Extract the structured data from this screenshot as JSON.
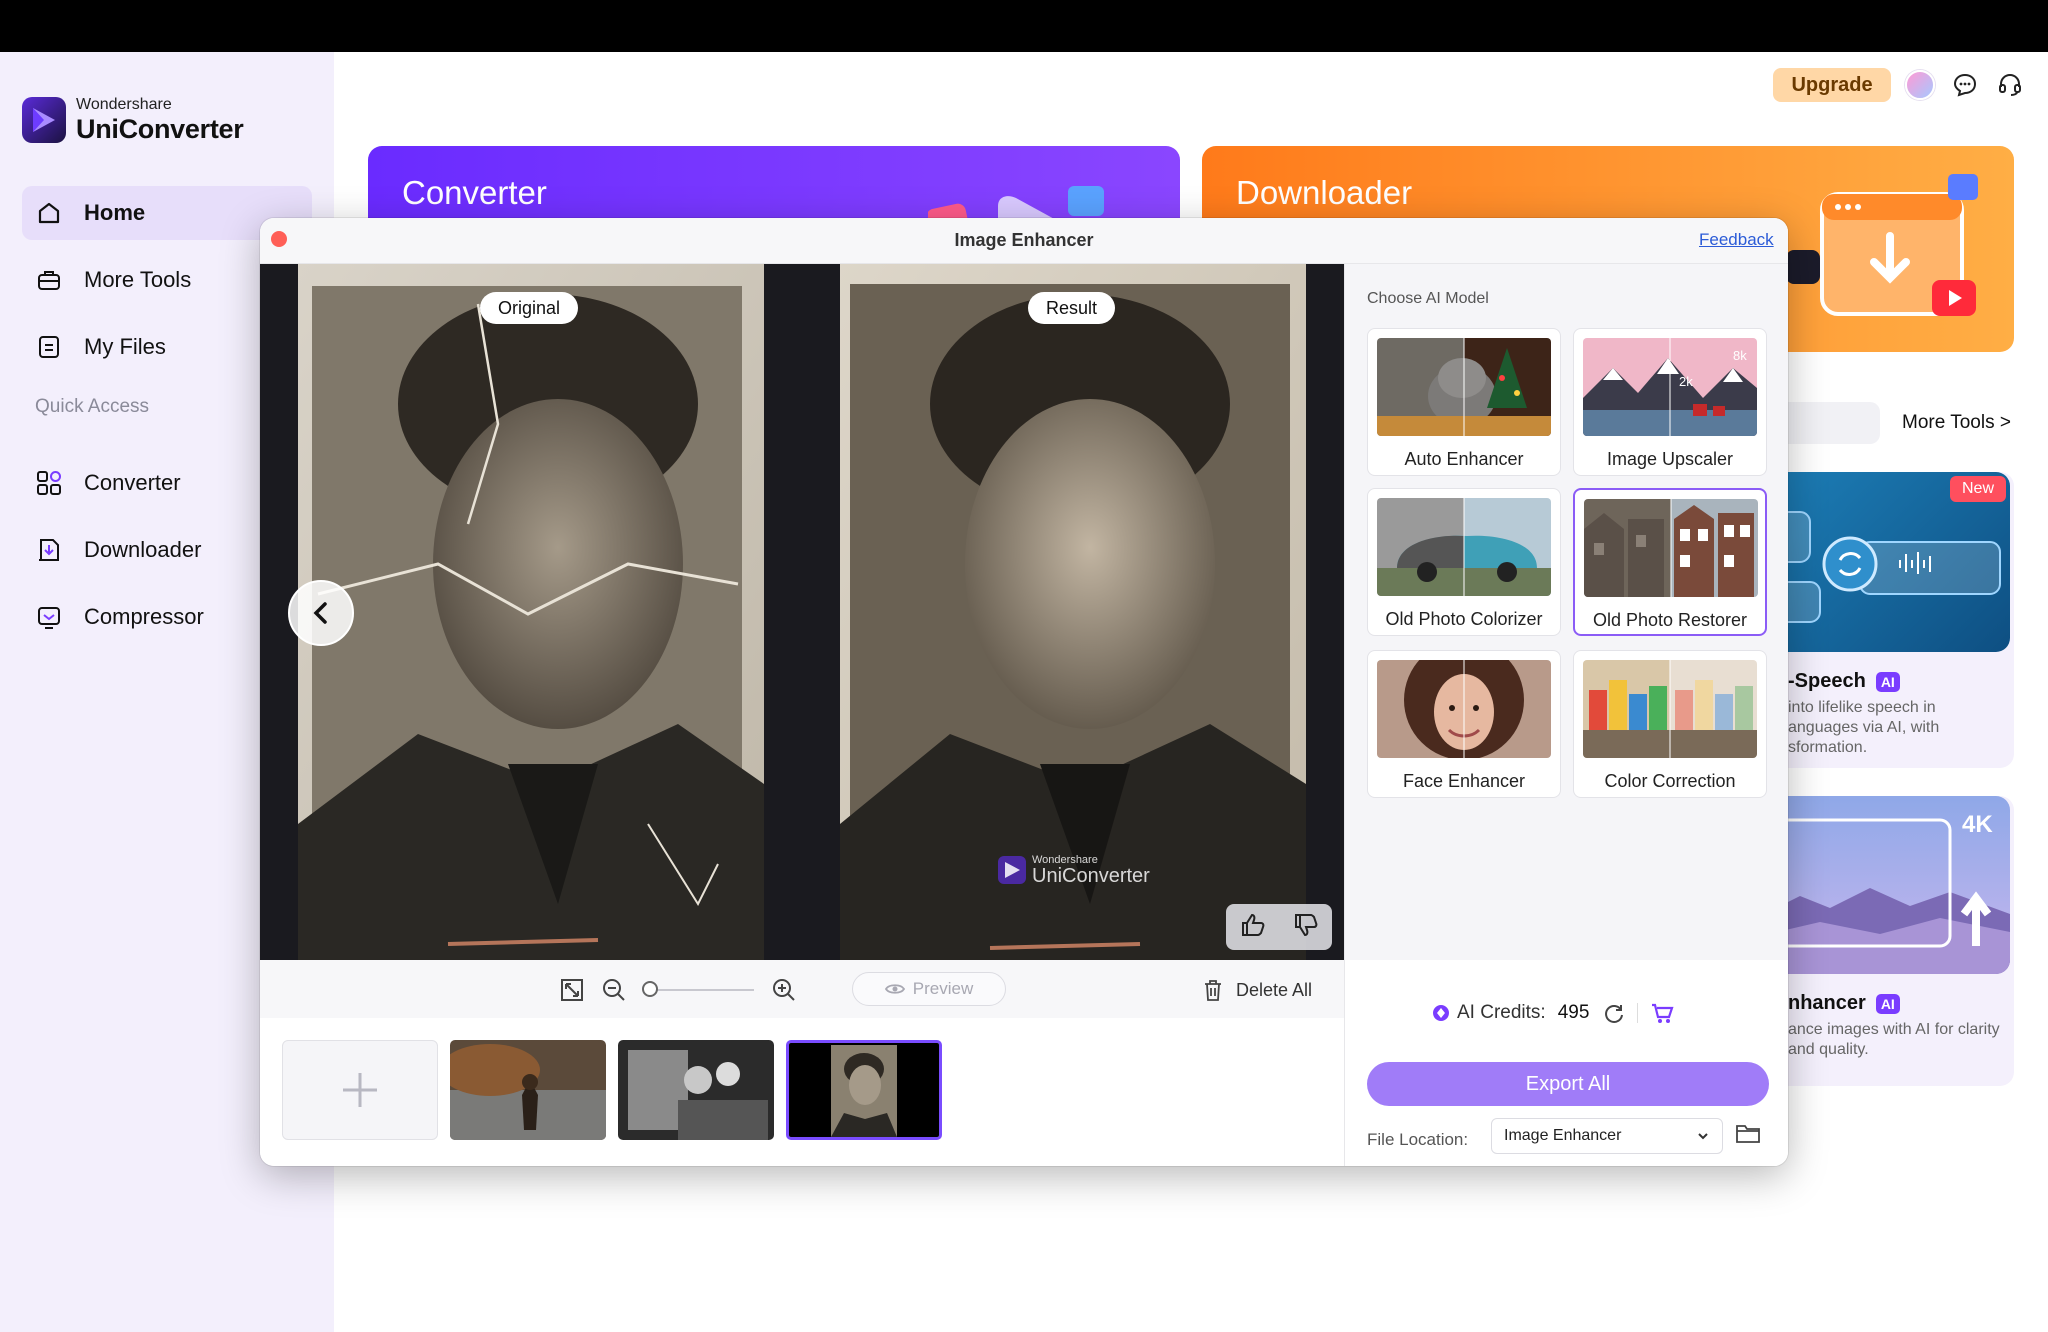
{
  "app": {
    "brand_small": "Wondershare",
    "brand_big": "UniConverter",
    "accent": "#7a3cff"
  },
  "sidebar": {
    "items": [
      {
        "label": "Home",
        "icon": "home-icon",
        "active": true
      },
      {
        "label": "More Tools",
        "icon": "toolbox-icon"
      },
      {
        "label": "My Files",
        "icon": "files-icon"
      }
    ],
    "quick_access_label": "Quick Access",
    "quick_items": [
      {
        "label": "Converter",
        "icon": "converter-icon"
      },
      {
        "label": "Downloader",
        "icon": "downloader-icon"
      },
      {
        "label": "Compressor",
        "icon": "compressor-icon"
      }
    ]
  },
  "header": {
    "upgrade_label": "Upgrade"
  },
  "cards": {
    "converter_title": "Converter",
    "downloader_title": "Downloader",
    "more_tools_link": "More Tools >",
    "new_badge": "New",
    "speech_title": "-Speech",
    "speech_desc": "into lifelike speech in anguages via AI, with sformation.",
    "enhancer_title": "nhancer",
    "enhancer_desc": "ance images with AI for clarity and quality.",
    "ai_badge": "AI",
    "fourk_label": "4K"
  },
  "modal": {
    "title": "Image Enhancer",
    "feedback_link": "Feedback",
    "original_label": "Original",
    "result_label": "Result",
    "watermark_small": "Wondershare",
    "watermark_big": "UniConverter",
    "preview_label": "Preview",
    "delete_all_label": "Delete All"
  },
  "panel": {
    "choose_label": "Choose AI Model",
    "models": [
      {
        "name": "Auto Enhancer"
      },
      {
        "name": "Image Upscaler"
      },
      {
        "name": "Old Photo Colorizer"
      },
      {
        "name": "Old Photo Restorer",
        "selected": true
      },
      {
        "name": "Face Enhancer"
      },
      {
        "name": "Color Correction"
      }
    ],
    "upscaler_8k": "8k",
    "upscaler_2k": "2k",
    "credits_label": "AI Credits:",
    "credits_value": "495",
    "export_label": "Export All",
    "location_label": "File Location:",
    "location_value": "Image Enhancer"
  }
}
